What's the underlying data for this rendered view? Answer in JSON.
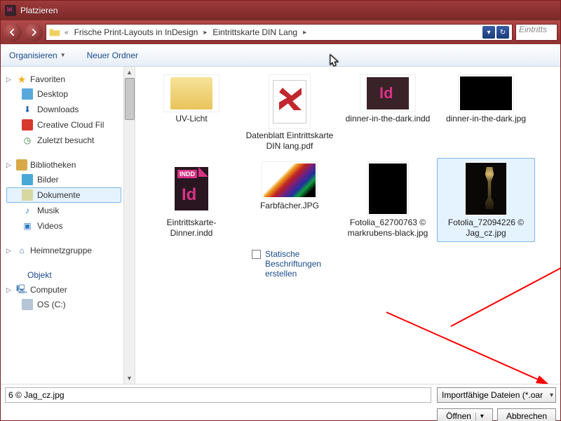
{
  "window": {
    "title": "Platzieren"
  },
  "nav": {
    "back_history_prefix": "«",
    "path": [
      "Frische Print-Layouts in InDesign",
      "Eintrittskarte DIN Lang"
    ],
    "search_placeholder": "Eintritts"
  },
  "toolbar": {
    "organize": "Organisieren",
    "new_folder": "Neuer Ordner"
  },
  "sidebar": {
    "favorites": {
      "label": "Favoriten",
      "items": [
        "Desktop",
        "Downloads",
        "Creative Cloud Fil",
        "Zuletzt besucht"
      ]
    },
    "libraries": {
      "label": "Bibliotheken",
      "items": [
        "Bilder",
        "Dokumente",
        "Musik",
        "Videos"
      ]
    },
    "homegroup": {
      "label": "Heimnetzgruppe"
    },
    "computer": {
      "label": "Computer",
      "items": [
        "OS (C:)"
      ]
    },
    "objekt_link": "Objekt"
  },
  "files": {
    "row1": [
      {
        "name": "UV-Licht"
      },
      {
        "name": "Datenblatt Eintrittskarte DIN lang.pdf"
      },
      {
        "name": "dinner-in-the-dark.indd"
      },
      {
        "name": "dinner-in-the-dark.jpg"
      }
    ],
    "row2": [
      {
        "name": "Eintrittskarte-Dinner.indd"
      },
      {
        "name": "Farbfächer.JPG"
      },
      {
        "name": "Fotolia_62700763 © markrubens-black.jpg"
      },
      {
        "name": "Fotolia_72094226 © Jag_cz.jpg"
      }
    ]
  },
  "static_captions": {
    "label": "Statische Beschriftungen erstellen"
  },
  "footer": {
    "filename": "6 © Jag_cz.jpg",
    "filter": "Importfähige Dateien (*.oar",
    "open": "Öffnen",
    "cancel": "Abbrechen"
  }
}
